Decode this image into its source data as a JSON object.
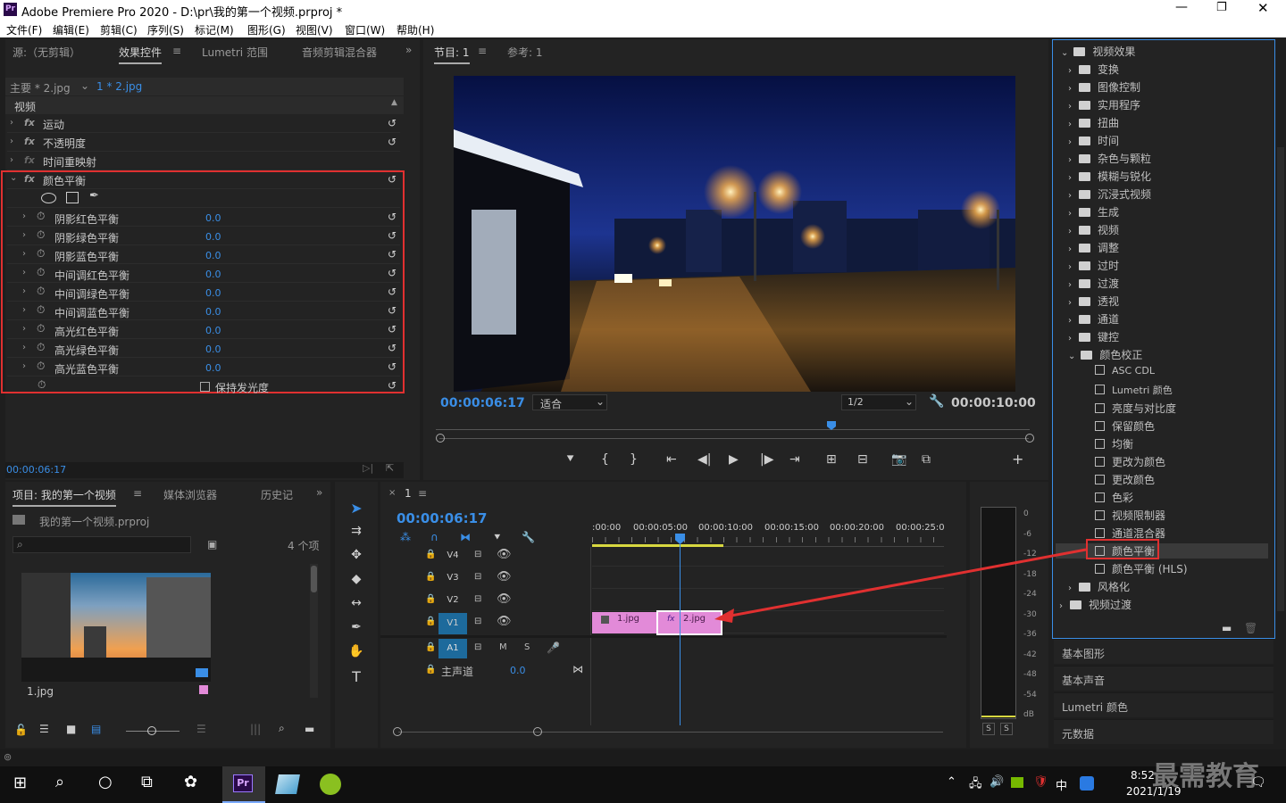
{
  "window": {
    "title": "Adobe Premiere Pro 2020 - D:\\pr\\我的第一个视频.prproj *",
    "app_icon": "Pr"
  },
  "menu": [
    "文件(F)",
    "编辑(E)",
    "剪辑(C)",
    "序列(S)",
    "标记(M)",
    "图形(G)",
    "视图(V)",
    "窗口(W)",
    "帮助(H)"
  ],
  "source_tabs": {
    "source": "源:（无剪辑）",
    "effect_controls": "效果控件",
    "lumetri_scope": "Lumetri 范围",
    "audio_mixer": "音频剪辑混合器"
  },
  "ec": {
    "master": "主要 * 2.jpg",
    "clip": "1 * 2.jpg",
    "video_header": "视频",
    "fixed": [
      {
        "label": "运动"
      },
      {
        "label": "不透明度"
      },
      {
        "label": "时间重映射"
      }
    ],
    "color_balance": "颜色平衡",
    "params": [
      {
        "label": "阴影红色平衡",
        "value": "0.0"
      },
      {
        "label": "阴影绿色平衡",
        "value": "0.0"
      },
      {
        "label": "阴影蓝色平衡",
        "value": "0.0"
      },
      {
        "label": "中间调红色平衡",
        "value": "0.0"
      },
      {
        "label": "中间调绿色平衡",
        "value": "0.0"
      },
      {
        "label": "中间调蓝色平衡",
        "value": "0.0"
      },
      {
        "label": "高光红色平衡",
        "value": "0.0"
      },
      {
        "label": "高光绿色平衡",
        "value": "0.0"
      },
      {
        "label": "高光蓝色平衡",
        "value": "0.0"
      }
    ],
    "preserve": "保持发光度",
    "time": "00:00:06:17",
    "highlight_color": "#e03030"
  },
  "program": {
    "tab": "节目: 1",
    "ref": "参考: 1",
    "timecode": "00:00:06:17",
    "fit": "适合",
    "res": "1/2",
    "duration": "00:00:10:00"
  },
  "project": {
    "tab": "项目: 我的第一个视频",
    "media": "媒体浏览器",
    "history": "历史记",
    "file": "我的第一个视频.prproj",
    "count": "4 个项",
    "thumb": "1.jpg"
  },
  "timeline": {
    "seq": "1",
    "timecode": "00:00:06:17",
    "ruler": [
      ":00:00",
      "00:00:05:00",
      "00:00:10:00",
      "00:00:15:00",
      "00:00:20:00",
      "00:00:25:0"
    ],
    "tracks": [
      {
        "name": "V4"
      },
      {
        "name": "V3"
      },
      {
        "name": "V2"
      },
      {
        "name": "V1"
      }
    ],
    "audio": "A1",
    "audio_m": "M",
    "audio_s": "S",
    "master": "主声道",
    "master_val": "0.0",
    "clips": [
      {
        "name": "1.jpg"
      },
      {
        "name": "2.jpg"
      }
    ],
    "clip_color": "#e28ad8"
  },
  "meter": {
    "scale": [
      "0",
      "-6",
      "-12",
      "-18",
      "-24",
      "-30",
      "-36",
      "-42",
      "-48",
      "-54",
      "dB"
    ],
    "solo": [
      "S",
      "S"
    ]
  },
  "effects": {
    "root": "视频效果",
    "folders": [
      "变换",
      "图像控制",
      "实用程序",
      "扭曲",
      "时间",
      "杂色与颗粒",
      "模糊与锐化",
      "沉浸式视频",
      "生成",
      "视频",
      "调整",
      "过时",
      "过渡",
      "透视",
      "通道",
      "键控"
    ],
    "color_correction": "颜色校正",
    "cc_items": [
      "ASC CDL",
      "Lumetri 颜色",
      "亮度与对比度",
      "保留颜色",
      "均衡",
      "更改为颜色",
      "更改颜色",
      "色彩",
      "视频限制器",
      "通道混合器",
      "颜色平衡",
      "颜色平衡 (HLS)"
    ],
    "stylize": "风格化",
    "transitions": "视频过渡"
  },
  "sections": [
    "基本图形",
    "基本声音",
    "Lumetri 颜色",
    "元数据"
  ],
  "taskbar": {
    "time": "8:52",
    "date": "2021/1/19",
    "ime": "中",
    "watermark": "最需教育"
  }
}
